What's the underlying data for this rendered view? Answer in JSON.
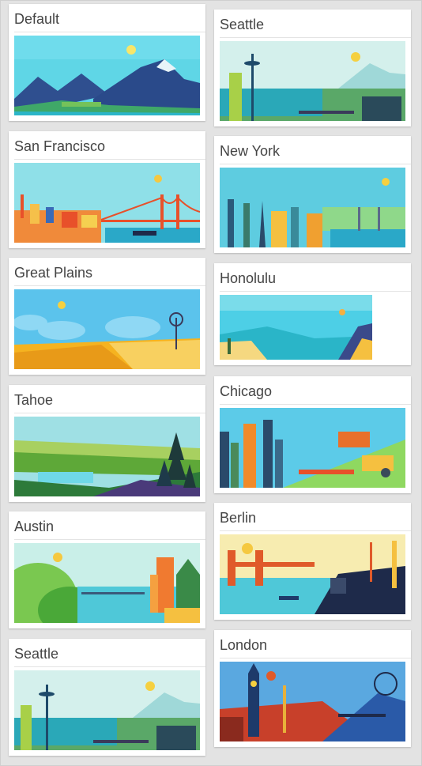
{
  "themes_left": [
    {
      "name": "Default",
      "scene": "mountains",
      "colors": {
        "sky": "#5fd6e6",
        "accent": "#2a4a8a"
      }
    },
    {
      "name": "San Francisco",
      "scene": "bridge",
      "colors": {
        "sky": "#8fe0e8",
        "accent": "#e8502a"
      }
    },
    {
      "name": "Great Plains",
      "scene": "plains",
      "colors": {
        "sky": "#5bc3ec",
        "accent": "#f5b320"
      }
    },
    {
      "name": "Tahoe",
      "scene": "forest",
      "colors": {
        "sky": "#9fe0e4",
        "accent": "#4a3a7a"
      }
    },
    {
      "name": "Austin",
      "scene": "austin",
      "colors": {
        "sky": "#c9efe8",
        "accent": "#f07a30"
      }
    },
    {
      "name": "Seattle",
      "scene": "seattle",
      "colors": {
        "sky": "#d4f0ec",
        "accent": "#1e4a6a"
      }
    }
  ],
  "themes_right": [
    {
      "name": "Seattle",
      "scene": "seattle",
      "colors": {
        "sky": "#d4f0ec",
        "accent": "#1e4a6a"
      }
    },
    {
      "name": "New York",
      "scene": "newyork",
      "colors": {
        "sky": "#5ecce0",
        "accent": "#2a5a7a"
      }
    },
    {
      "name": "Honolulu",
      "scene": "honolulu",
      "colors": {
        "sky": "#4dcfe6",
        "accent": "#3a4a8a"
      }
    },
    {
      "name": "Chicago",
      "scene": "chicago",
      "colors": {
        "sky": "#5ccbe8",
        "accent": "#e8702a"
      }
    },
    {
      "name": "Berlin",
      "scene": "berlin",
      "colors": {
        "sky": "#f7ecb0",
        "accent": "#e05a2a"
      }
    },
    {
      "name": "London",
      "scene": "london",
      "colors": {
        "sky": "#5aa8e0",
        "accent": "#c8402a"
      }
    }
  ]
}
